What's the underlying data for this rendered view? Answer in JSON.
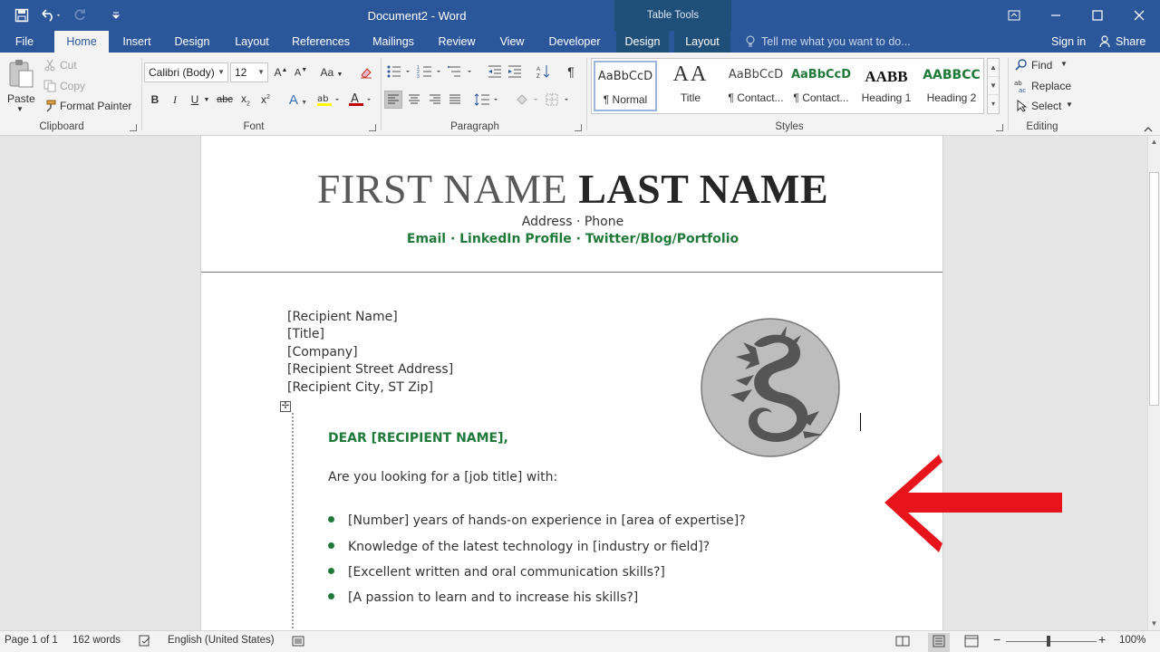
{
  "titlebar": {
    "title": "Document2 - Word",
    "context_tab_group": "Table Tools"
  },
  "tabs": {
    "file": "File",
    "home": "Home",
    "insert": "Insert",
    "design": "Design",
    "layout": "Layout",
    "references": "References",
    "mailings": "Mailings",
    "review": "Review",
    "view": "View",
    "developer": "Developer",
    "table_design": "Design",
    "table_layout": "Layout",
    "tell_me": "Tell me what you want to do...",
    "sign_in": "Sign in",
    "share": "Share"
  },
  "ribbon": {
    "clipboard": {
      "label": "Clipboard",
      "paste": "Paste",
      "cut": "Cut",
      "copy": "Copy",
      "format_painter": "Format Painter"
    },
    "font": {
      "label": "Font",
      "family": "Calibri (Body)",
      "size": "12"
    },
    "paragraph": {
      "label": "Paragraph"
    },
    "styles": {
      "label": "Styles",
      "items": [
        {
          "preview": "AaBbCcD",
          "name": "¶ Normal"
        },
        {
          "preview": "AA",
          "name": "Title"
        },
        {
          "preview": "AaBbCcD",
          "name": "¶ Contact..."
        },
        {
          "preview": "AaBbCcD",
          "name": "¶ Contact..."
        },
        {
          "preview": "AABB",
          "name": "Heading 1"
        },
        {
          "preview": "AABBCC",
          "name": "Heading 2"
        }
      ]
    },
    "editing": {
      "label": "Editing",
      "find": "Find",
      "replace": "Replace",
      "select": "Select"
    }
  },
  "document": {
    "first_name": "FIRST NAME",
    "last_name": "LAST NAME",
    "address_line": "Address · Phone",
    "contact_line": "Email · LinkedIn Profile · Twitter/Blog/Portfolio",
    "recipient": [
      "[Recipient Name]",
      "[Title]",
      "[Company]",
      "[Recipient Street Address]",
      "[Recipient City, ST Zip]"
    ],
    "salutation": "DEAR [RECIPIENT NAME],",
    "intro": "Are you looking for a [job title] with:",
    "bullets": [
      "[Number] years of hands-on experience in [area of expertise]?",
      "Knowledge of the latest technology in [industry or field]?",
      "[Excellent written and oral communication skills?]",
      "[A passion to learn and to increase his skills?]"
    ]
  },
  "statusbar": {
    "page": "Page 1 of 1",
    "words": "162 words",
    "language": "English (United States)",
    "zoom": "100%"
  },
  "colors": {
    "word_blue": "#2b579a",
    "accent_green": "#1f7a3a",
    "arrow_red": "#e8141c"
  }
}
